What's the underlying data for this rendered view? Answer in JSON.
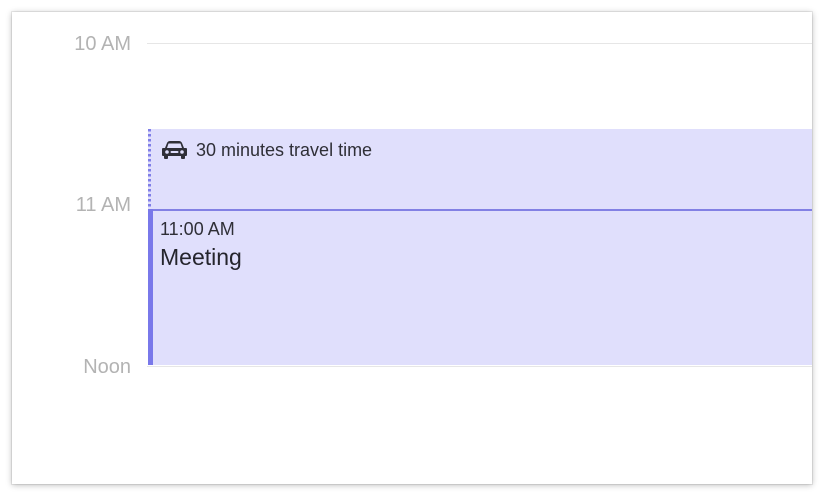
{
  "timeline": {
    "hours": [
      {
        "label": "10 AM"
      },
      {
        "label": "11 AM"
      },
      {
        "label": "Noon"
      }
    ]
  },
  "travel": {
    "icon": "car-icon",
    "text": "30 minutes travel time"
  },
  "event": {
    "time": "11:00 AM",
    "title": "Meeting"
  },
  "colors": {
    "event_background": "#e0dffc",
    "event_accent": "#7978ea",
    "hour_label": "#b3b3b3",
    "grid_line": "#e6e6e6"
  }
}
